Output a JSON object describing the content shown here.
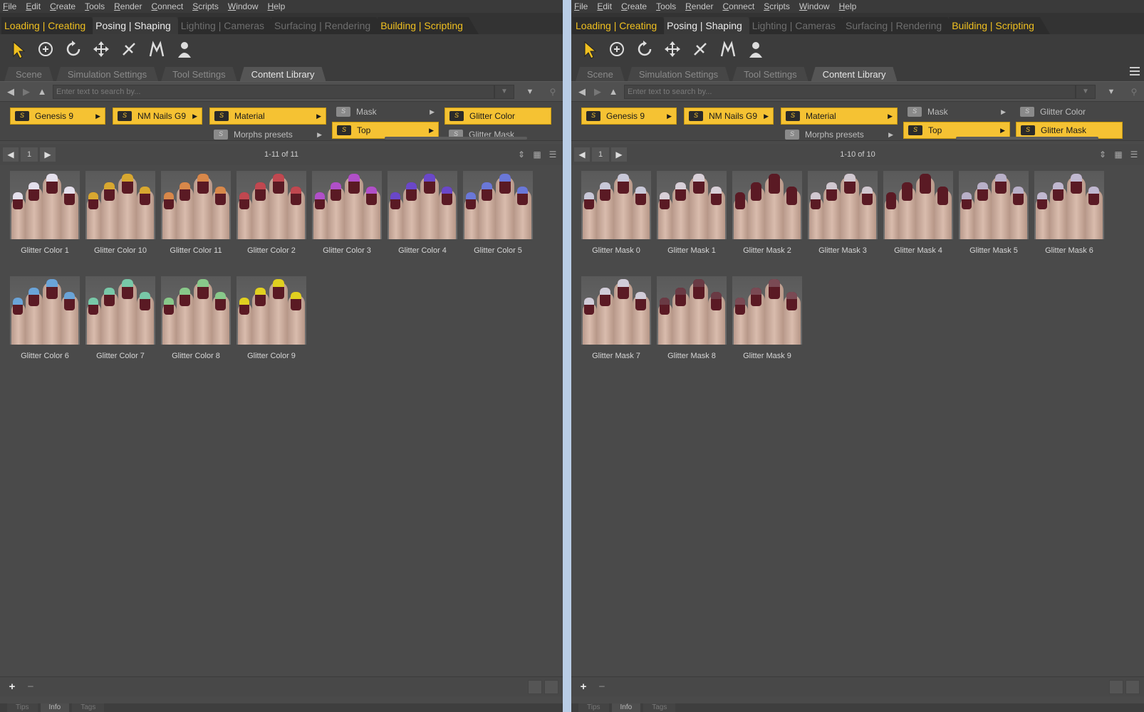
{
  "menu": [
    "File",
    "Edit",
    "Create",
    "Tools",
    "Render",
    "Connect",
    "Scripts",
    "Window",
    "Help"
  ],
  "activities": [
    {
      "label": "Loading | Creating",
      "style": "yellow"
    },
    {
      "label": "Posing | Shaping",
      "style": "white"
    },
    {
      "label": "Lighting | Cameras",
      "style": "dim"
    },
    {
      "label": "Surfacing | Rendering",
      "style": "dim"
    },
    {
      "label": "Building | Scripting",
      "style": "yellow"
    }
  ],
  "tools": [
    "pointer-icon",
    "universal-tool-icon",
    "rotate-icon",
    "translate-icon",
    "joint-editor-icon",
    "morph-icon",
    "figure-tool-icon"
  ],
  "tabs": [
    "Scene",
    "Simulation Settings",
    "Tool Settings",
    "Content Library"
  ],
  "active_tab": "Content Library",
  "search": {
    "placeholder": "Enter text to search by..."
  },
  "bottom_tabs": [
    "Tips",
    "Info",
    "Tags"
  ],
  "colors": {
    "accent": "#f5c233",
    "panel": "#4a4a4a",
    "divider": "#b9cde6"
  },
  "panes": [
    {
      "breadcrumb": {
        "genesis": "Genesis 9",
        "nails": "NM Nails G9",
        "material": "Material",
        "morphs": "Morphs presets",
        "mask": "Mask",
        "top": "Top",
        "glitter_color": "Glitter Color",
        "glitter_mask": "Glitter Mask",
        "selected_last": "glitter_color"
      },
      "page": "1",
      "count": "1-11 of 11",
      "items": [
        {
          "label": "Glitter Color 1",
          "tip": "#e4e0ec"
        },
        {
          "label": "Glitter Color 10",
          "tip": "#d8a830"
        },
        {
          "label": "Glitter Color 11",
          "tip": "#d8884a"
        },
        {
          "label": "Glitter Color 2",
          "tip": "#c04850"
        },
        {
          "label": "Glitter Color 3",
          "tip": "#b050c8"
        },
        {
          "label": "Glitter Color 4",
          "tip": "#6a48c8"
        },
        {
          "label": "Glitter Color 5",
          "tip": "#6a78d8"
        },
        {
          "label": "Glitter Color 6",
          "tip": "#6aa4d8"
        },
        {
          "label": "Glitter Color 7",
          "tip": "#78c8a8"
        },
        {
          "label": "Glitter Color 8",
          "tip": "#88c88a"
        },
        {
          "label": "Glitter Color 9",
          "tip": "#e0d020"
        }
      ]
    },
    {
      "breadcrumb": {
        "genesis": "Genesis 9",
        "nails": "NM Nails G9",
        "material": "Material",
        "morphs": "Morphs presets",
        "mask": "Mask",
        "top": "Top",
        "glitter_color": "Glitter Color",
        "glitter_mask": "Glitter Mask",
        "selected_last": "glitter_mask"
      },
      "page": "1",
      "count": "1-10 of 10",
      "items": [
        {
          "label": "Glitter Mask 0",
          "tip": "#c8c8d8"
        },
        {
          "label": "Glitter Mask 1",
          "tip": "#d8d0d8"
        },
        {
          "label": "Glitter Mask 2",
          "tip": "#5a1a24"
        },
        {
          "label": "Glitter Mask 3",
          "tip": "#d0c8d0"
        },
        {
          "label": "Glitter Mask 4",
          "tip": "#5a1a24"
        },
        {
          "label": "Glitter Mask 5",
          "tip": "#b8b0c8"
        },
        {
          "label": "Glitter Mask 6",
          "tip": "#c0b8d0"
        },
        {
          "label": "Glitter Mask 7",
          "tip": "#d0ccd8"
        },
        {
          "label": "Glitter Mask 8",
          "tip": "#6a3a44"
        },
        {
          "label": "Glitter Mask 9",
          "tip": "#7a4a54"
        }
      ]
    }
  ]
}
